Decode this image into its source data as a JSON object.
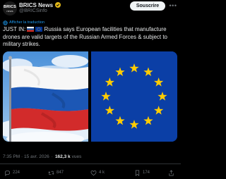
{
  "account": {
    "avatar_line1": "BRICS",
    "avatar_line2": "news",
    "name": "BRICS News",
    "handle": "@BRICSinfo"
  },
  "header": {
    "subscribe_label": "Souscrire",
    "more_icon": "more-dots-icon"
  },
  "translate_label": "Afficher la traduction",
  "tweet": {
    "prefix": "JUST IN:",
    "body": "Russia says European facilities that manufacture drones are valid targets of the Russian Armed Forces & subject to military strikes."
  },
  "meta": {
    "timestamp": "7:35 PM · 15 avr. 2026",
    "separator": "·",
    "views_count": "162,3 k",
    "views_label": "vues"
  },
  "actions": {
    "replies": "224",
    "reposts": "847",
    "likes": "4 k",
    "bookmarks": "174"
  },
  "colors": {
    "background": "#000000",
    "accent": "#1d9bf0",
    "muted": "#71767b",
    "eu_blue": "#0b3fa6",
    "eu_star": "#ffcc00"
  }
}
